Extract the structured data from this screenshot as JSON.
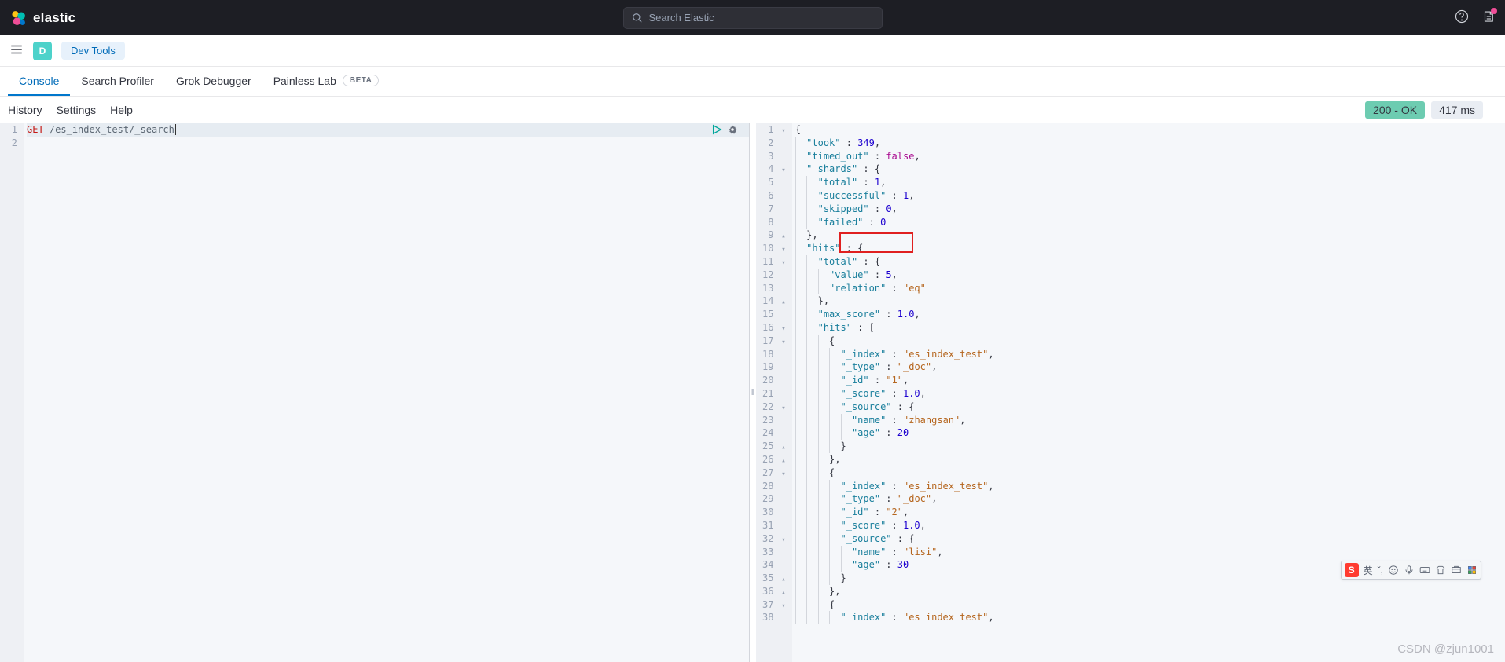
{
  "header": {
    "brand": "elastic",
    "search_placeholder": "Search Elastic",
    "space_letter": "D",
    "breadcrumb": "Dev Tools"
  },
  "tabs": [
    {
      "id": "console",
      "label": "Console",
      "active": true
    },
    {
      "id": "profiler",
      "label": "Search Profiler"
    },
    {
      "id": "grok",
      "label": "Grok Debugger"
    },
    {
      "id": "painless",
      "label": "Painless Lab",
      "badge": "BETA"
    }
  ],
  "toolbar": {
    "history": "History",
    "settings": "Settings",
    "help": "Help",
    "status": "200 - OK",
    "latency": "417 ms"
  },
  "request": {
    "method": "GET",
    "path": "/es_index_test/_search"
  },
  "response_lines": [
    {
      "n": 1,
      "fold": "▾",
      "indent": 0,
      "tokens": [
        [
          "punc",
          "{"
        ]
      ]
    },
    {
      "n": 2,
      "indent": 1,
      "tokens": [
        [
          "key",
          "\"took\""
        ],
        [
          "punc",
          " : "
        ],
        [
          "num",
          "349"
        ],
        [
          "punc",
          ","
        ]
      ]
    },
    {
      "n": 3,
      "indent": 1,
      "tokens": [
        [
          "key",
          "\"timed_out\""
        ],
        [
          "punc",
          " : "
        ],
        [
          "bool",
          "false"
        ],
        [
          "punc",
          ","
        ]
      ]
    },
    {
      "n": 4,
      "fold": "▾",
      "indent": 1,
      "tokens": [
        [
          "key",
          "\"_shards\""
        ],
        [
          "punc",
          " : {"
        ]
      ]
    },
    {
      "n": 5,
      "indent": 2,
      "tokens": [
        [
          "key",
          "\"total\""
        ],
        [
          "punc",
          " : "
        ],
        [
          "num",
          "1"
        ],
        [
          "punc",
          ","
        ]
      ]
    },
    {
      "n": 6,
      "indent": 2,
      "tokens": [
        [
          "key",
          "\"successful\""
        ],
        [
          "punc",
          " : "
        ],
        [
          "num",
          "1"
        ],
        [
          "punc",
          ","
        ]
      ]
    },
    {
      "n": 7,
      "indent": 2,
      "tokens": [
        [
          "key",
          "\"skipped\""
        ],
        [
          "punc",
          " : "
        ],
        [
          "num",
          "0"
        ],
        [
          "punc",
          ","
        ]
      ]
    },
    {
      "n": 8,
      "indent": 2,
      "tokens": [
        [
          "key",
          "\"failed\""
        ],
        [
          "punc",
          " : "
        ],
        [
          "num",
          "0"
        ]
      ]
    },
    {
      "n": 9,
      "fold": "▴",
      "indent": 1,
      "tokens": [
        [
          "punc",
          "},"
        ]
      ]
    },
    {
      "n": 10,
      "fold": "▾",
      "indent": 1,
      "tokens": [
        [
          "key",
          "\"hits\""
        ],
        [
          "punc",
          " : {"
        ]
      ]
    },
    {
      "n": 11,
      "fold": "▾",
      "indent": 2,
      "tokens": [
        [
          "key",
          "\"total\""
        ],
        [
          "punc",
          " : {"
        ]
      ]
    },
    {
      "n": 12,
      "indent": 3,
      "tokens": [
        [
          "key",
          "\"value\""
        ],
        [
          "punc",
          " : "
        ],
        [
          "num",
          "5"
        ],
        [
          "punc",
          ","
        ]
      ]
    },
    {
      "n": 13,
      "indent": 3,
      "tokens": [
        [
          "key",
          "\"relation\""
        ],
        [
          "punc",
          " : "
        ],
        [
          "str",
          "\"eq\""
        ]
      ]
    },
    {
      "n": 14,
      "fold": "▴",
      "indent": 2,
      "tokens": [
        [
          "punc",
          "},"
        ]
      ]
    },
    {
      "n": 15,
      "indent": 2,
      "tokens": [
        [
          "key",
          "\"max_score\""
        ],
        [
          "punc",
          " : "
        ],
        [
          "num",
          "1.0"
        ],
        [
          "punc",
          ","
        ]
      ]
    },
    {
      "n": 16,
      "fold": "▾",
      "indent": 2,
      "tokens": [
        [
          "key",
          "\"hits\""
        ],
        [
          "punc",
          " : ["
        ]
      ]
    },
    {
      "n": 17,
      "fold": "▾",
      "indent": 3,
      "tokens": [
        [
          "punc",
          "{"
        ]
      ]
    },
    {
      "n": 18,
      "indent": 4,
      "tokens": [
        [
          "key",
          "\"_index\""
        ],
        [
          "punc",
          " : "
        ],
        [
          "str",
          "\"es_index_test\""
        ],
        [
          "punc",
          ","
        ]
      ]
    },
    {
      "n": 19,
      "indent": 4,
      "tokens": [
        [
          "key",
          "\"_type\""
        ],
        [
          "punc",
          " : "
        ],
        [
          "str",
          "\"_doc\""
        ],
        [
          "punc",
          ","
        ]
      ]
    },
    {
      "n": 20,
      "indent": 4,
      "tokens": [
        [
          "key",
          "\"_id\""
        ],
        [
          "punc",
          " : "
        ],
        [
          "str",
          "\"1\""
        ],
        [
          "punc",
          ","
        ]
      ]
    },
    {
      "n": 21,
      "indent": 4,
      "tokens": [
        [
          "key",
          "\"_score\""
        ],
        [
          "punc",
          " : "
        ],
        [
          "num",
          "1.0"
        ],
        [
          "punc",
          ","
        ]
      ]
    },
    {
      "n": 22,
      "fold": "▾",
      "indent": 4,
      "tokens": [
        [
          "key",
          "\"_source\""
        ],
        [
          "punc",
          " : {"
        ]
      ]
    },
    {
      "n": 23,
      "indent": 5,
      "tokens": [
        [
          "key",
          "\"name\""
        ],
        [
          "punc",
          " : "
        ],
        [
          "str",
          "\"zhangsan\""
        ],
        [
          "punc",
          ","
        ]
      ]
    },
    {
      "n": 24,
      "indent": 5,
      "tokens": [
        [
          "key",
          "\"age\""
        ],
        [
          "punc",
          " : "
        ],
        [
          "num",
          "20"
        ]
      ]
    },
    {
      "n": 25,
      "fold": "▴",
      "indent": 4,
      "tokens": [
        [
          "punc",
          "}"
        ]
      ]
    },
    {
      "n": 26,
      "fold": "▴",
      "indent": 3,
      "tokens": [
        [
          "punc",
          "},"
        ]
      ]
    },
    {
      "n": 27,
      "fold": "▾",
      "indent": 3,
      "tokens": [
        [
          "punc",
          "{"
        ]
      ]
    },
    {
      "n": 28,
      "indent": 4,
      "tokens": [
        [
          "key",
          "\"_index\""
        ],
        [
          "punc",
          " : "
        ],
        [
          "str",
          "\"es_index_test\""
        ],
        [
          "punc",
          ","
        ]
      ]
    },
    {
      "n": 29,
      "indent": 4,
      "tokens": [
        [
          "key",
          "\"_type\""
        ],
        [
          "punc",
          " : "
        ],
        [
          "str",
          "\"_doc\""
        ],
        [
          "punc",
          ","
        ]
      ]
    },
    {
      "n": 30,
      "indent": 4,
      "tokens": [
        [
          "key",
          "\"_id\""
        ],
        [
          "punc",
          " : "
        ],
        [
          "str",
          "\"2\""
        ],
        [
          "punc",
          ","
        ]
      ]
    },
    {
      "n": 31,
      "indent": 4,
      "tokens": [
        [
          "key",
          "\"_score\""
        ],
        [
          "punc",
          " : "
        ],
        [
          "num",
          "1.0"
        ],
        [
          "punc",
          ","
        ]
      ]
    },
    {
      "n": 32,
      "fold": "▾",
      "indent": 4,
      "tokens": [
        [
          "key",
          "\"_source\""
        ],
        [
          "punc",
          " : {"
        ]
      ]
    },
    {
      "n": 33,
      "indent": 5,
      "tokens": [
        [
          "key",
          "\"name\""
        ],
        [
          "punc",
          " : "
        ],
        [
          "str",
          "\"lisi\""
        ],
        [
          "punc",
          ","
        ]
      ]
    },
    {
      "n": 34,
      "indent": 5,
      "tokens": [
        [
          "key",
          "\"age\""
        ],
        [
          "punc",
          " : "
        ],
        [
          "num",
          "30"
        ]
      ]
    },
    {
      "n": 35,
      "fold": "▴",
      "indent": 4,
      "tokens": [
        [
          "punc",
          "}"
        ]
      ]
    },
    {
      "n": 36,
      "fold": "▴",
      "indent": 3,
      "tokens": [
        [
          "punc",
          "},"
        ]
      ]
    },
    {
      "n": 37,
      "fold": "▾",
      "indent": 3,
      "tokens": [
        [
          "punc",
          "{"
        ]
      ]
    },
    {
      "n": 38,
      "indent": 4,
      "tokens": [
        [
          "key",
          "\" index\""
        ],
        [
          "punc",
          " : "
        ],
        [
          "str",
          "\"es index test\""
        ],
        [
          "punc",
          ","
        ]
      ]
    }
  ],
  "ime": {
    "lang": "英",
    "spark": "ˇ,"
  },
  "watermark": "CSDN @zjun1001"
}
